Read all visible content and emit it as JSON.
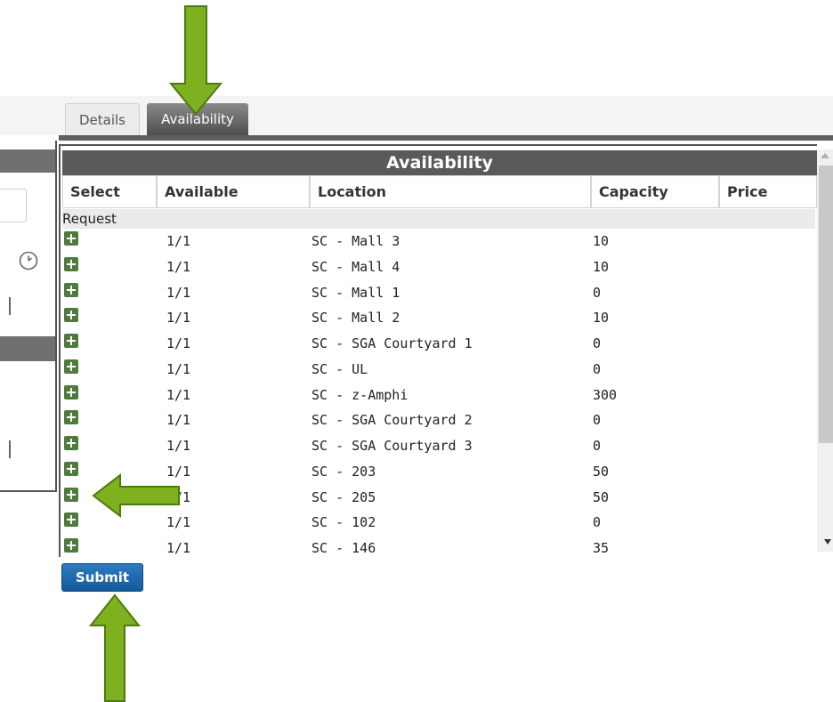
{
  "tabs": [
    {
      "label": "Details",
      "active": false
    },
    {
      "label": "Availability",
      "active": true
    }
  ],
  "panel": {
    "title": "Availability",
    "columns": [
      "Select",
      "Available",
      "Location",
      "Capacity",
      "Price"
    ],
    "group_label": "Request",
    "rows": [
      {
        "available": "1/1",
        "location": "SC - Mall 3",
        "capacity": "10",
        "price": ""
      },
      {
        "available": "1/1",
        "location": "SC - Mall 4",
        "capacity": "10",
        "price": ""
      },
      {
        "available": "1/1",
        "location": "SC - Mall 1",
        "capacity": "0",
        "price": ""
      },
      {
        "available": "1/1",
        "location": "SC - Mall 2",
        "capacity": "10",
        "price": ""
      },
      {
        "available": "1/1",
        "location": "SC - SGA Courtyard 1",
        "capacity": "0",
        "price": ""
      },
      {
        "available": "1/1",
        "location": "SC - UL",
        "capacity": "0",
        "price": ""
      },
      {
        "available": "1/1",
        "location": "SC - z-Amphi",
        "capacity": "300",
        "price": ""
      },
      {
        "available": "1/1",
        "location": "SC - SGA Courtyard 2",
        "capacity": "0",
        "price": ""
      },
      {
        "available": "1/1",
        "location": "SC - SGA Courtyard 3",
        "capacity": "0",
        "price": ""
      },
      {
        "available": "1/1",
        "location": "SC - 203",
        "capacity": "50",
        "price": ""
      },
      {
        "available": "1/1",
        "location": "SC - 205",
        "capacity": "50",
        "price": ""
      },
      {
        "available": "1/1",
        "location": "SC - 102",
        "capacity": "0",
        "price": ""
      },
      {
        "available": "1/1",
        "location": "SC - 146",
        "capacity": "35",
        "price": ""
      }
    ]
  },
  "submit_label": "Submit",
  "icons": {
    "select": "plus-icon",
    "time": "clock-icon",
    "annotation": "arrow-icon"
  },
  "colors": {
    "select_icon": "#4f7a3e",
    "submit": "#1a66ad",
    "annotation_arrow": "#7fb020",
    "header": "#5a5a5a"
  }
}
